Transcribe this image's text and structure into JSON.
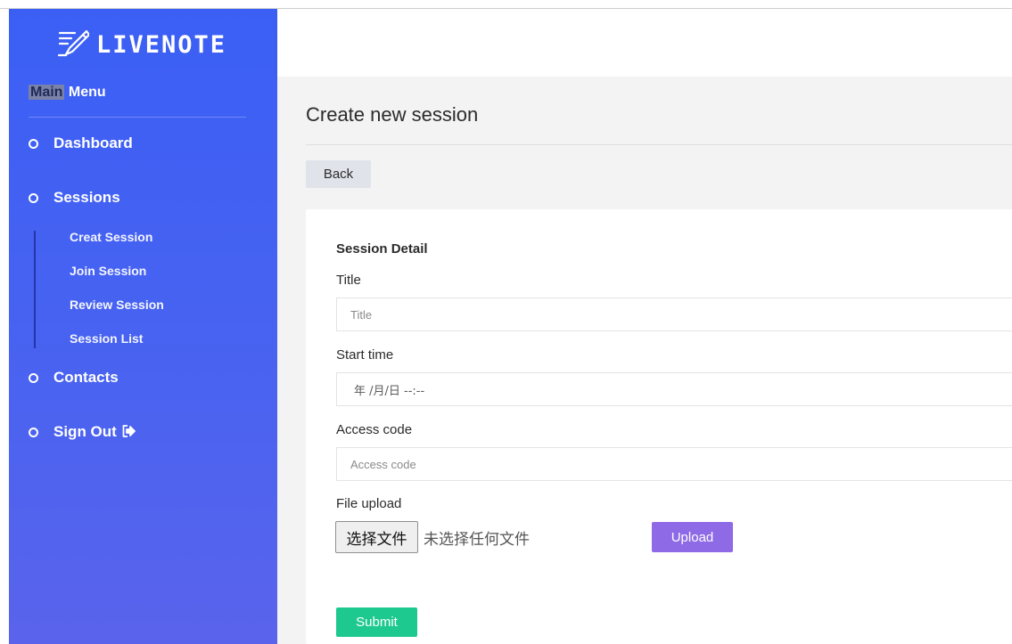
{
  "brand": {
    "name": "LIVENOTE",
    "logo_icon": "pen-writing-icon"
  },
  "sidebar": {
    "heading_highlight": "Main",
    "heading_rest": " Menu",
    "items": [
      {
        "label": "Dashboard"
      },
      {
        "label": "Sessions"
      },
      {
        "label": "Contacts"
      },
      {
        "label": "Sign Out",
        "icon": "sign-out-icon"
      }
    ],
    "sub_items": [
      {
        "label": "Creat Session"
      },
      {
        "label": "Join Session"
      },
      {
        "label": "Review Session"
      },
      {
        "label": "Session List"
      }
    ]
  },
  "main": {
    "title": "Create new session",
    "back_label": "Back",
    "form": {
      "section_title": "Session Detail",
      "title_label": "Title",
      "title_placeholder": "Title",
      "start_label": "Start time",
      "start_value": "年 /月/日 --:--",
      "access_label": "Access code",
      "access_placeholder": "Access code",
      "file_label": "File upload",
      "file_button": "选择文件",
      "file_status": "未选择任何文件",
      "upload_label": "Upload",
      "submit_label": "Submit"
    }
  },
  "colors": {
    "sidebar": "#3b5ff5",
    "upload": "#8e6ae6",
    "submit": "#1ec98f"
  }
}
